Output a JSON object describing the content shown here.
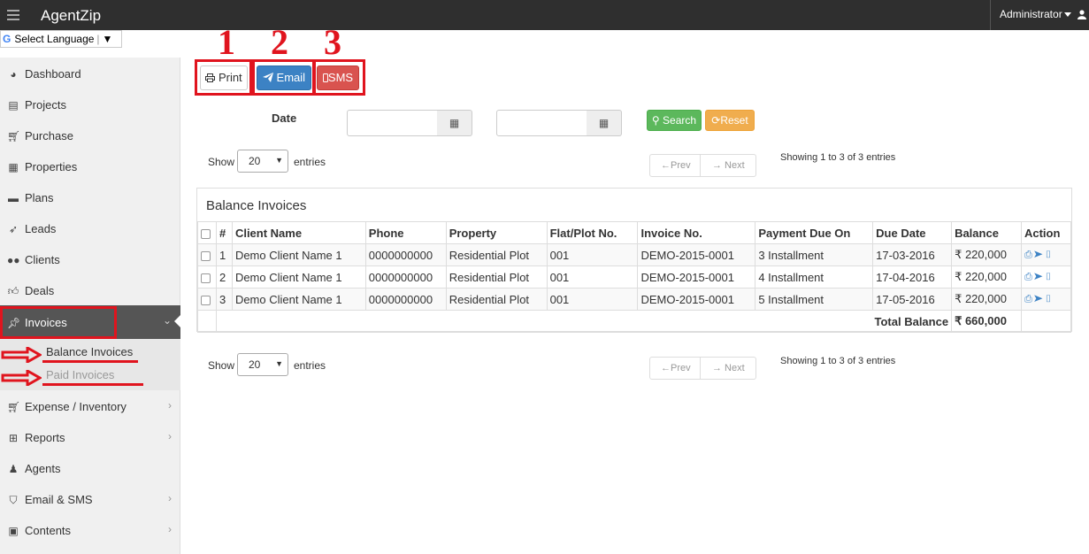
{
  "app": {
    "brand": "AgentZip",
    "user": "Administrator"
  },
  "language": {
    "label": "Select Language",
    "g": "G",
    "sep": "|",
    "dropdown": "▼"
  },
  "sidebar": {
    "items": [
      {
        "label": "Dashboard",
        "icon": "dashboard-icon"
      },
      {
        "label": "Projects",
        "icon": "projects-icon"
      },
      {
        "label": "Purchase",
        "icon": "cart-icon"
      },
      {
        "label": "Properties",
        "icon": "building-icon"
      },
      {
        "label": "Plans",
        "icon": "briefcase-icon"
      },
      {
        "label": "Leads",
        "icon": "rocket-icon"
      },
      {
        "label": "Clients",
        "icon": "users-icon"
      },
      {
        "label": "Deals",
        "icon": "thumbs-up-icon"
      },
      {
        "label": "Invoices",
        "icon": "pin-icon"
      },
      {
        "label": "Expense / Inventory",
        "icon": "cart-icon"
      },
      {
        "label": "Reports",
        "icon": "table-icon"
      },
      {
        "label": "Agents",
        "icon": "agent-icon"
      },
      {
        "label": "Email & SMS",
        "icon": "shield-icon"
      },
      {
        "label": "Contents",
        "icon": "newspaper-icon"
      }
    ],
    "sub_items": [
      {
        "label": "Balance Invoices"
      },
      {
        "label": "Paid Invoices"
      }
    ]
  },
  "annotations": {
    "n1": "1",
    "n2": "2",
    "n3": "3"
  },
  "toolbar": {
    "print": "Print",
    "email": "Email",
    "sms": "SMS"
  },
  "filter": {
    "date_label": "Date",
    "search": "Search",
    "reset": "Reset"
  },
  "length": {
    "show": "Show",
    "value": "20",
    "entries": "entries"
  },
  "pager": {
    "prev": "←Prev",
    "next": "→ Next"
  },
  "info": "Showing 1 to 3 of 3 entries",
  "table": {
    "title": "Balance Invoices",
    "headers": [
      "#",
      "Client Name",
      "Phone",
      "Property",
      "Flat/Plot No.",
      "Invoice No.",
      "Payment Due On",
      "Due Date",
      "Balance",
      "Action"
    ],
    "rows": [
      {
        "n": "1",
        "client": "Demo Client Name 1",
        "phone": "0000000000",
        "property": "Residential Plot",
        "plot": "001",
        "invoice": "DEMO-2015-0001",
        "due_on": "3 Installment",
        "due_date": "17-03-2016",
        "balance": "₹ 220,000"
      },
      {
        "n": "2",
        "client": "Demo Client Name 1",
        "phone": "0000000000",
        "property": "Residential Plot",
        "plot": "001",
        "invoice": "DEMO-2015-0001",
        "due_on": "4 Installment",
        "due_date": "17-04-2016",
        "balance": "₹ 220,000"
      },
      {
        "n": "3",
        "client": "Demo Client Name 1",
        "phone": "0000000000",
        "property": "Residential Plot",
        "plot": "001",
        "invoice": "DEMO-2015-0001",
        "due_on": "5 Installment",
        "due_date": "17-05-2016",
        "balance": "₹ 220,000"
      }
    ],
    "total_label": "Total Balance",
    "total_value": "₹ 660,000"
  },
  "colors": {
    "topbar": "#2f2f2f",
    "primary": "#3c82c4",
    "danger": "#d9534f",
    "success": "#5cb85c",
    "warning": "#f0ad4e",
    "annotation": "#e0141e"
  }
}
